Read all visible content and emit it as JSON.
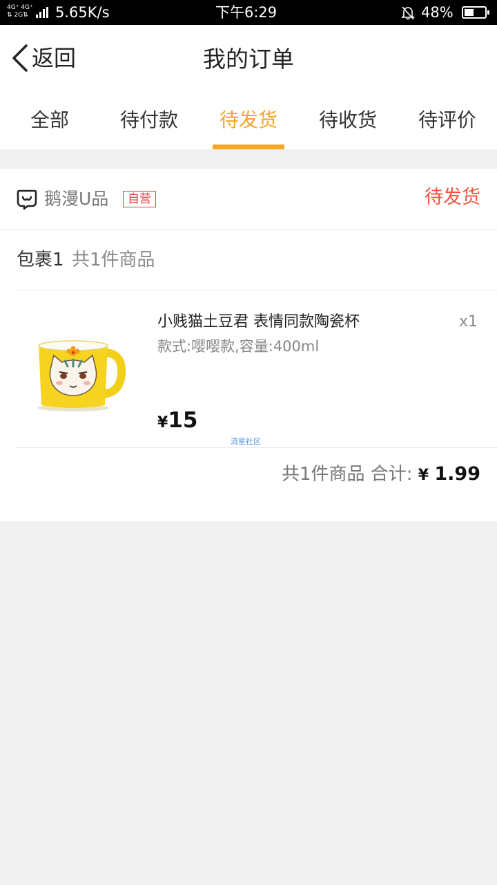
{
  "status_bar": {
    "network_line1": "4G⁺ 4G⁺",
    "network_line2": "⇅ 2G⇅",
    "speed": "5.65K/s",
    "time": "下午6:29",
    "battery": "48%",
    "battery_level": 0.48
  },
  "nav": {
    "back_label": "返回",
    "title": "我的订单"
  },
  "tabs": [
    {
      "label": "全部",
      "active": false
    },
    {
      "label": "待付款",
      "active": false
    },
    {
      "label": "待发货",
      "active": true
    },
    {
      "label": "待收货",
      "active": false
    },
    {
      "label": "待评价",
      "active": false
    }
  ],
  "order": {
    "shop_name": "鹅漫U品",
    "self_badge": "自营",
    "status": "待发货",
    "package_label": "包裹1",
    "package_count": "共1件商品",
    "item": {
      "title": "小贱猫土豆君 表情同款陶瓷杯",
      "quantity": "x1",
      "spec": "款式:嘤嘤款,容量:400ml",
      "currency": "¥",
      "price": "15",
      "image_icon": "cat-mug-image"
    },
    "watermark": "流星社区",
    "summary_prefix": "共1件商品 合计:",
    "total_currency": "¥",
    "total": "1.99"
  },
  "colors": {
    "accent": "#f5a623",
    "status_red": "#f0533b",
    "badge_red": "#e23b3b"
  }
}
